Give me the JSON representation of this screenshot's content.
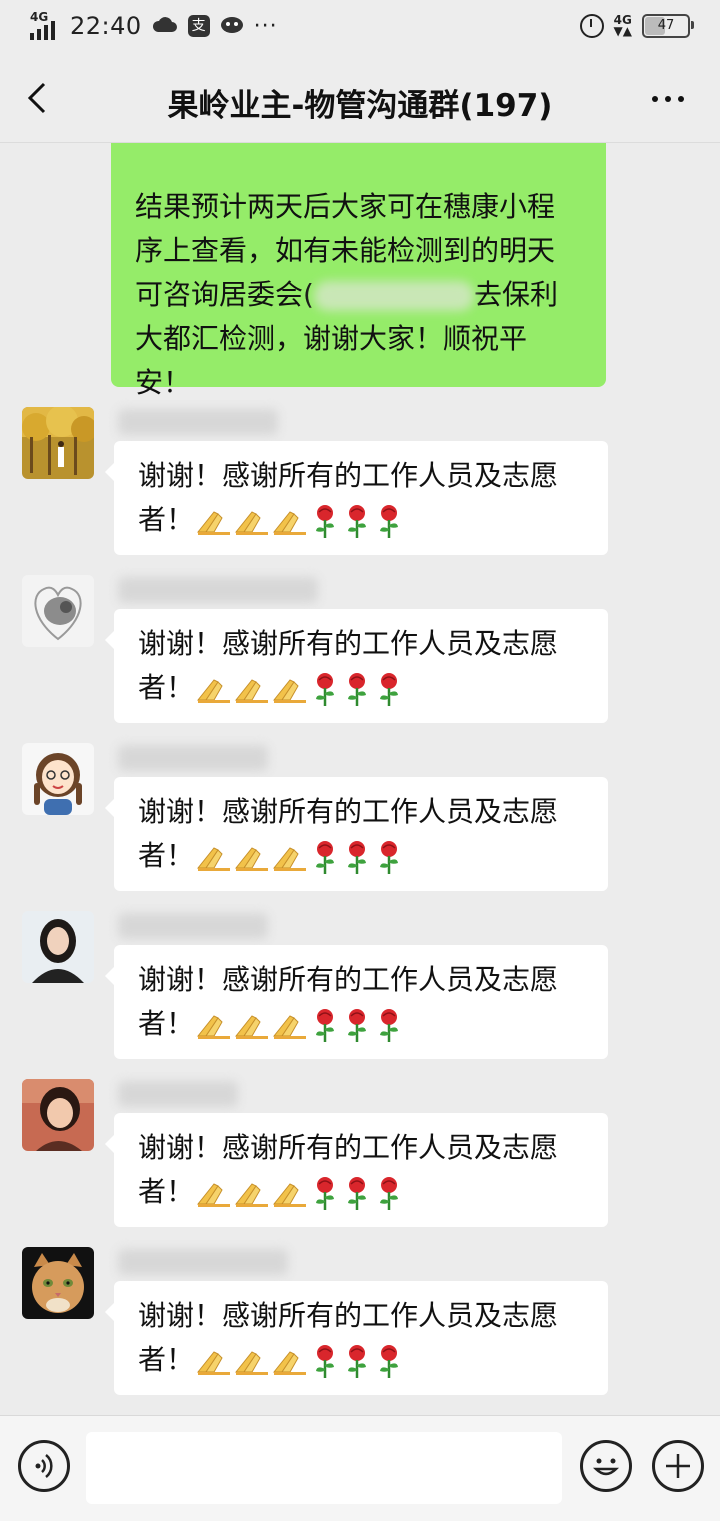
{
  "status_bar": {
    "network": "4G",
    "time": "22:40",
    "battery": "47"
  },
  "header": {
    "title": "果岭业主-物管沟通群(197)"
  },
  "own_message": {
    "lines": [
      "结果预计两天后大家可在穗康小程",
      "序上查看，如有未能检测到的明天",
      "大都汇检测，谢谢大家！顺祝平",
      "安！"
    ],
    "line4_prefix": "可咨询居委会(",
    "line4_suffix": "去保利"
  },
  "messages": [
    {
      "avatar": "avatar-trees",
      "line1": "谢谢！感谢所有的工作人员及志愿",
      "line2": "者！"
    },
    {
      "avatar": "avatar-sketch",
      "line1": "谢谢！感谢所有的工作人员及志愿",
      "line2": "者！"
    },
    {
      "avatar": "avatar-cartoon-girl",
      "line1": "谢谢！感谢所有的工作人员及志愿",
      "line2": "者！"
    },
    {
      "avatar": "avatar-woman-portrait",
      "line1": "谢谢！感谢所有的工作人员及志愿",
      "line2": "者！"
    },
    {
      "avatar": "avatar-woman-photo",
      "line1": "谢谢！感谢所有的工作人员及志愿",
      "line2": "者！"
    },
    {
      "avatar": "avatar-cat",
      "line1": "谢谢！感谢所有的工作人员及志愿",
      "line2": "者！"
    }
  ],
  "emoji_sequence": [
    "pray-emoji",
    "pray-emoji",
    "pray-emoji",
    "rose-emoji",
    "rose-emoji",
    "rose-emoji"
  ],
  "input_bar": {
    "icons": [
      "voice-icon",
      "emoji-icon",
      "plus-icon"
    ]
  }
}
